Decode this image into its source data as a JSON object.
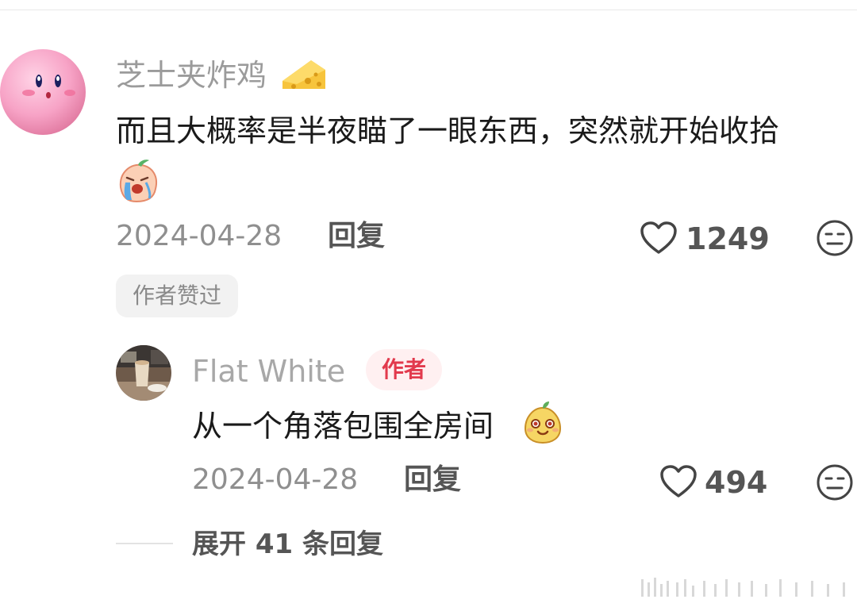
{
  "comment": {
    "username": "芝士夹炸鸡",
    "username_icon": "cheese-emoji",
    "text": "而且大概率是半夜瞄了一眼东西，突然就开始收拾",
    "trailing_icon": "crying-peach-emoji",
    "date": "2024-04-28",
    "reply_label": "回复",
    "likes": "1249",
    "liked_by_author_badge": "作者赞过"
  },
  "reply": {
    "username": "Flat White",
    "author_badge": "作者",
    "text": "从一个角落包围全房间",
    "trailing_icon": "sly-pear-emoji",
    "date": "2024-04-28",
    "reply_label": "回复",
    "likes": "494"
  },
  "expand": {
    "label": "展开 41 条回复"
  },
  "colors": {
    "author_badge_text": "#e23a4d",
    "author_badge_bg": "#fff0f1",
    "username": "#9b9b9b",
    "body_text": "#1a1a1a"
  }
}
